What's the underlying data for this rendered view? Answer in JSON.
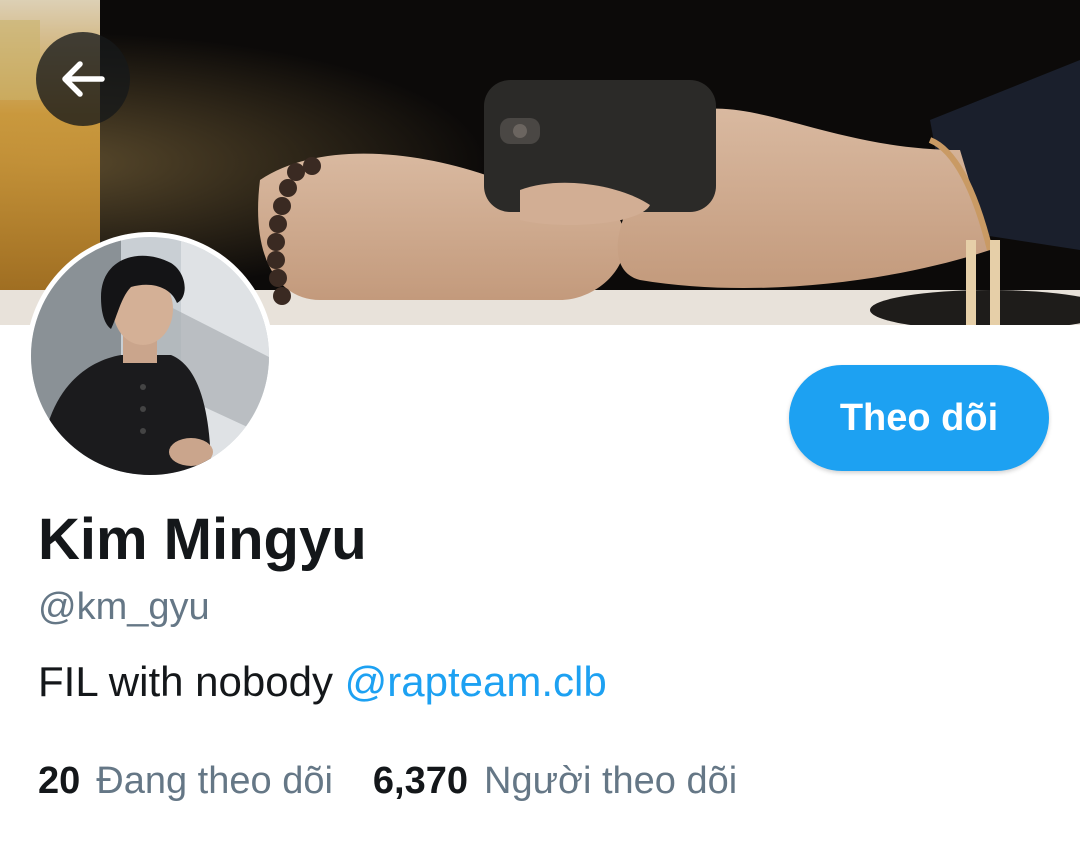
{
  "profile": {
    "display_name": "Kim Mingyu",
    "handle": "@km_gyu",
    "bio_text": "FIL with nobody ",
    "bio_mention": "@rapteam.clb"
  },
  "actions": {
    "follow_label": "Theo dõi"
  },
  "stats": {
    "following_count": "20",
    "following_label": "Đang theo dõi",
    "followers_count": "6,370",
    "followers_label": "Người theo dõi"
  },
  "icons": {
    "back": "arrow-left-icon"
  },
  "colors": {
    "accent": "#1da1f2",
    "primary_text": "#14171a",
    "secondary_text": "#657786"
  }
}
